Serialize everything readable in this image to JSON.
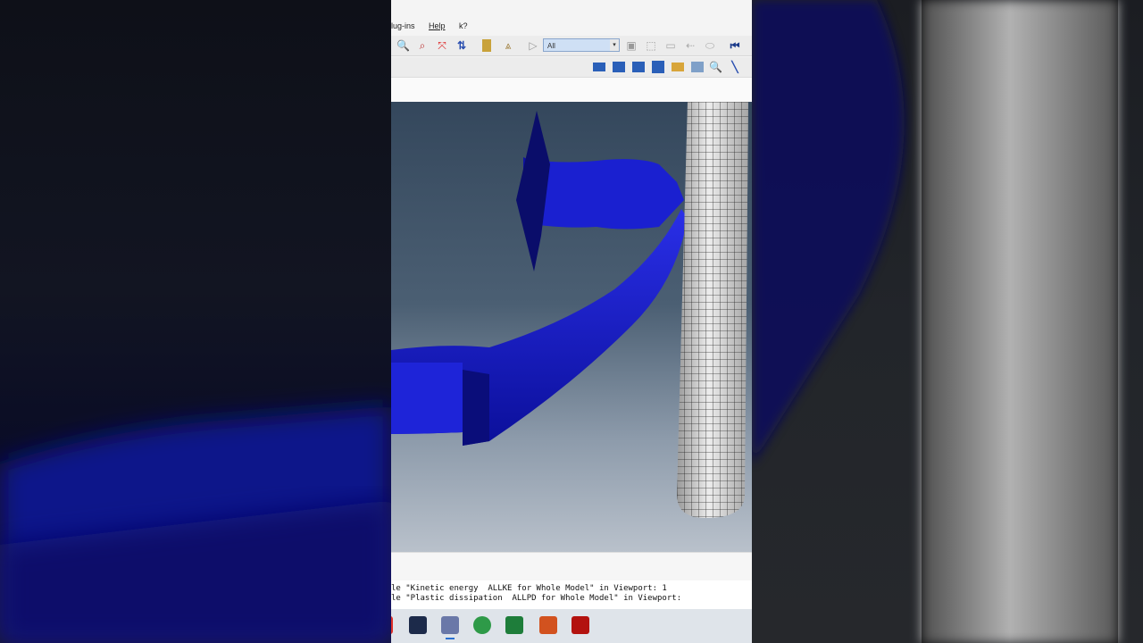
{
  "menu": {
    "plugins": "lug-ins",
    "help": "Help",
    "help_cursor": "k?"
  },
  "toolbar": {
    "selection_filter": "All",
    "icons": [
      "zoom-icon",
      "zoom-box-icon",
      "fit-view-icon",
      "rotate-icon",
      "box-icon",
      "pan-icon",
      "select-cursor-icon",
      "filter-icon",
      "query-icon",
      "view-icon",
      "view-back-icon",
      "view-fwd-icon",
      "first-frame-icon"
    ],
    "row2_icons": [
      "view-single-icon",
      "view-stack-icon",
      "view-split-icon",
      "view-tile-icon",
      "camera-icon",
      "table-icon",
      "magnifier-icon",
      "line-tool-icon"
    ]
  },
  "messages": [
    "le \"Kinetic energy  ALLKE for Whole Model\" in Viewport: 1",
    "le \"Plastic dissipation  ALLPD for Whole Model\" in Viewport:"
  ],
  "taskbar": [
    "teamviewer-icon",
    "abaqus-icon",
    "browser-icon",
    "excel-icon",
    "presentation-icon",
    "pdf-icon"
  ],
  "colors": {
    "part_blue": "#1a1fd0",
    "pillar_grid": "#333333",
    "viewport_top": "#34475c",
    "viewport_bottom": "#b9c1cb"
  }
}
